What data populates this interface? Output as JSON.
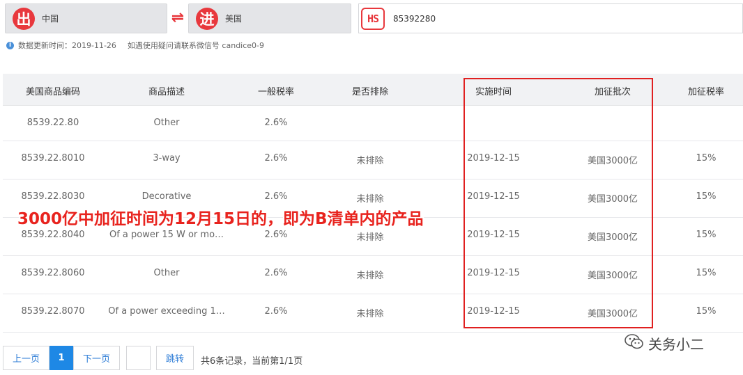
{
  "header": {
    "export_badge": "出",
    "export_country": "中国",
    "swap_symbol": "⇌",
    "import_badge": "进",
    "import_country": "美国",
    "hs_badge": "HS",
    "hs_value": "85392280"
  },
  "info": {
    "update_text": "数据更新时间：2019-11-26",
    "contact_text": "如遇使用疑问请联系微信号 candice0-9"
  },
  "table": {
    "columns": [
      "美国商品编码",
      "商品描述",
      "一般税率",
      "是否排除",
      "实施时间",
      "加征批次",
      "加征税率"
    ],
    "rows": [
      [
        "8539.22.80",
        "Other",
        "2.6%",
        "",
        "",
        "",
        ""
      ],
      [
        "8539.22.8010",
        "3-way",
        "2.6%",
        "未排除",
        "2019-12-15",
        "美国3000亿",
        "15%"
      ],
      [
        "8539.22.8030",
        "Decorative",
        "2.6%",
        "未排除",
        "2019-12-15",
        "美国3000亿",
        "15%"
      ],
      [
        "8539.22.8040",
        "Of a power 15 W or mo…",
        "2.6%",
        "未排除",
        "2019-12-15",
        "美国3000亿",
        "15%"
      ],
      [
        "8539.22.8060",
        "Other",
        "2.6%",
        "未排除",
        "2019-12-15",
        "美国3000亿",
        "15%"
      ],
      [
        "8539.22.8070",
        "Of a power exceeding 1…",
        "2.6%",
        "未排除",
        "2019-12-15",
        "美国3000亿",
        "15%"
      ]
    ]
  },
  "annotation": {
    "text": "3000亿中加征时间为12月15日的，即为B清单内的产品",
    "color": "#e8231e"
  },
  "pagination": {
    "prev": "上一页",
    "current": "1",
    "next": "下一页",
    "jump_input": "",
    "jump": "跳转",
    "summary": "共6条记录，当前第1/1页"
  },
  "watermark": {
    "text": "关务小二",
    "icon": "wechat-icon"
  },
  "colors": {
    "accent_red": "#e8383d",
    "frame_red": "#e02020",
    "active_blue": "#1e88e5"
  }
}
